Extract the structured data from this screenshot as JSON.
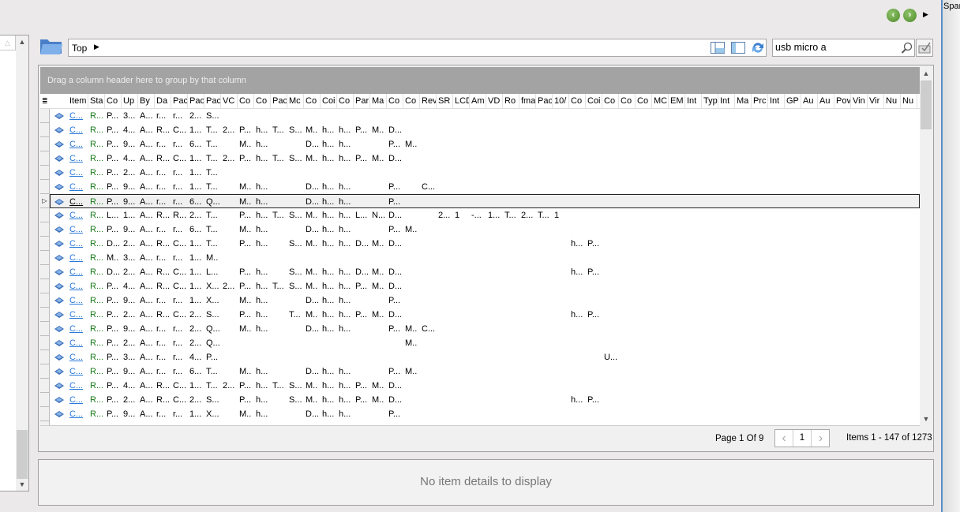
{
  "left_panel": {
    "sort_indicator": "△"
  },
  "nav": {
    "back_icon": "green-back-arrow",
    "forward_icon": "green-forward-arrow",
    "more_icon": "triangle-right"
  },
  "path": {
    "value": "Top",
    "arrow": "▸"
  },
  "search": {
    "value": "usb micro a"
  },
  "grid": {
    "group_hint": "Drag a column header here to group by that column",
    "columns": [
      "Item",
      "Sta",
      "Co",
      "Up",
      "By",
      "Da",
      "Pac",
      "Pac",
      "Pac",
      "VC",
      "Co",
      "Co",
      "Pac",
      "Mc",
      "Co",
      "Coi",
      "Co",
      "Par",
      "Ma",
      "Co",
      "Co",
      "Rev",
      "SR",
      "LCD",
      "Am",
      "VD",
      "Ro",
      "fma",
      "Pac",
      "10/",
      "Co",
      "Coi",
      "Co",
      "Co",
      "Co",
      "MC",
      "EM",
      "Int",
      "Typ",
      "Int",
      "Ma",
      "Prc",
      "Int",
      "GP",
      "Au",
      "Au",
      "Pov",
      "Vin",
      "Vir",
      "Nu",
      "Nu"
    ],
    "selected_row": 6,
    "rows": [
      [
        "C...",
        "R...",
        "P...",
        "3...",
        "A...",
        "r...",
        "r...",
        "2...",
        "S..."
      ],
      [
        "C...",
        "R...",
        "P...",
        "4...",
        "A...",
        "R...",
        "C...",
        "1...",
        "T...",
        "2...",
        "P...",
        "h...",
        "T...",
        "S...",
        "M..",
        "h...",
        "h...",
        "P...",
        "M..",
        "D..."
      ],
      [
        "C...",
        "R...",
        "P...",
        "9...",
        "A...",
        "r...",
        "r...",
        "6...",
        "T...",
        "",
        "M..",
        "h...",
        "",
        "",
        "D...",
        "h...",
        "h...",
        "",
        "",
        "P...",
        "M.."
      ],
      [
        "C...",
        "R...",
        "P...",
        "4...",
        "A...",
        "R...",
        "C...",
        "1...",
        "T...",
        "2...",
        "P...",
        "h...",
        "T...",
        "S...",
        "M..",
        "h...",
        "h...",
        "P...",
        "M..",
        "D..."
      ],
      [
        "C...",
        "R...",
        "P...",
        "2...",
        "A...",
        "r...",
        "r...",
        "1...",
        "T..."
      ],
      [
        "C...",
        "R...",
        "P...",
        "9...",
        "A...",
        "r...",
        "r...",
        "1...",
        "T...",
        "",
        "M..",
        "h...",
        "",
        "",
        "D...",
        "h...",
        "h...",
        "",
        "",
        "P...",
        "",
        "C..."
      ],
      [
        "C...",
        "R...",
        "P...",
        "9...",
        "A...",
        "r...",
        "r...",
        "6...",
        "Q...",
        "",
        "M..",
        "h...",
        "",
        "",
        "D...",
        "h...",
        "h...",
        "",
        "",
        "P..."
      ],
      [
        "C...",
        "R...",
        "L...",
        "1...",
        "A...",
        "R...",
        "R...",
        "2...",
        "T...",
        "",
        "P...",
        "h...",
        "T...",
        "S...",
        "M..",
        "h...",
        "h...",
        "L...",
        "N...",
        "D...",
        "",
        "",
        "2...",
        "1",
        "-...",
        "1...",
        "T...",
        "2...",
        "T...",
        "1"
      ],
      [
        "C...",
        "R...",
        "P...",
        "9...",
        "A...",
        "r...",
        "r...",
        "6...",
        "T...",
        "",
        "M..",
        "h...",
        "",
        "",
        "D...",
        "h...",
        "h...",
        "",
        "",
        "P...",
        "M.."
      ],
      [
        "C...",
        "R...",
        "D...",
        "2...",
        "A...",
        "R...",
        "C...",
        "1...",
        "T...",
        "",
        "P...",
        "h...",
        "",
        "S...",
        "M..",
        "h...",
        "h...",
        "D...",
        "M..",
        "D...",
        "",
        "",
        "",
        "",
        "",
        "",
        "",
        "",
        "",
        "",
        "h...",
        "P..."
      ],
      [
        "C...",
        "R...",
        "M..",
        "3...",
        "A...",
        "r...",
        "r...",
        "1...",
        "M.."
      ],
      [
        "C...",
        "R...",
        "D...",
        "2...",
        "A...",
        "R...",
        "C...",
        "1...",
        "L...",
        "",
        "P...",
        "h...",
        "",
        "S...",
        "M..",
        "h...",
        "h...",
        "D...",
        "M..",
        "D...",
        "",
        "",
        "",
        "",
        "",
        "",
        "",
        "",
        "",
        "",
        "h...",
        "P..."
      ],
      [
        "C...",
        "R...",
        "P...",
        "4...",
        "A...",
        "R...",
        "C...",
        "1...",
        "X...",
        "2...",
        "P...",
        "h...",
        "T...",
        "S...",
        "M..",
        "h...",
        "h...",
        "P...",
        "M..",
        "D..."
      ],
      [
        "C...",
        "R...",
        "P...",
        "9...",
        "A...",
        "r...",
        "r...",
        "1...",
        "X...",
        "",
        "M..",
        "h...",
        "",
        "",
        "D...",
        "h...",
        "h...",
        "",
        "",
        "P..."
      ],
      [
        "C...",
        "R...",
        "P...",
        "2...",
        "A...",
        "R...",
        "C...",
        "2...",
        "S...",
        "",
        "P...",
        "h...",
        "",
        "T...",
        "M..",
        "h...",
        "h...",
        "P...",
        "M..",
        "D...",
        "",
        "",
        "",
        "",
        "",
        "",
        "",
        "",
        "",
        "",
        "h...",
        "P..."
      ],
      [
        "C...",
        "R...",
        "P...",
        "9...",
        "A...",
        "r...",
        "r...",
        "2...",
        "Q...",
        "",
        "M..",
        "h...",
        "",
        "",
        "D...",
        "h...",
        "h...",
        "",
        "",
        "P...",
        "M..",
        "C..."
      ],
      [
        "C...",
        "R...",
        "P...",
        "2...",
        "A...",
        "r...",
        "r...",
        "2...",
        "Q...",
        "",
        "",
        "",
        "",
        "",
        "",
        "",
        "",
        "",
        "",
        "",
        "M.."
      ],
      [
        "C...",
        "R...",
        "P...",
        "3...",
        "A...",
        "r...",
        "r...",
        "4...",
        "P...",
        "",
        "",
        "",
        "",
        "",
        "",
        "",
        "",
        "",
        "",
        "",
        "",
        "",
        "",
        "",
        "",
        "",
        "",
        "",
        "",
        "",
        "",
        "",
        "U..."
      ],
      [
        "C...",
        "R...",
        "P...",
        "9...",
        "A...",
        "r...",
        "r...",
        "6...",
        "T...",
        "",
        "M..",
        "h...",
        "",
        "",
        "D...",
        "h...",
        "h...",
        "",
        "",
        "P...",
        "M.."
      ],
      [
        "C...",
        "R...",
        "P...",
        "4...",
        "A...",
        "R...",
        "C...",
        "1...",
        "T...",
        "2...",
        "P...",
        "h...",
        "T...",
        "S...",
        "M..",
        "h...",
        "h...",
        "P...",
        "M..",
        "D..."
      ],
      [
        "C...",
        "R...",
        "P...",
        "2...",
        "A...",
        "R...",
        "C...",
        "2...",
        "S...",
        "",
        "P...",
        "h...",
        "",
        "S...",
        "M..",
        "h...",
        "h...",
        "P...",
        "M..",
        "D...",
        "",
        "",
        "",
        "",
        "",
        "",
        "",
        "",
        "",
        "",
        "h...",
        "P..."
      ],
      [
        "C...",
        "R...",
        "P...",
        "9...",
        "A...",
        "r...",
        "r...",
        "1...",
        "X...",
        "",
        "M..",
        "h...",
        "",
        "",
        "D...",
        "h...",
        "h...",
        "",
        "",
        "P..."
      ],
      []
    ]
  },
  "pager": {
    "page_text": "Page 1 Of 9",
    "prev": "‹",
    "current": "1",
    "next": "›",
    "items_text": "Items 1 - 147 of 1273"
  },
  "details": {
    "empty_text": "No item details to display"
  },
  "right_panel": {
    "title": "Spar"
  }
}
